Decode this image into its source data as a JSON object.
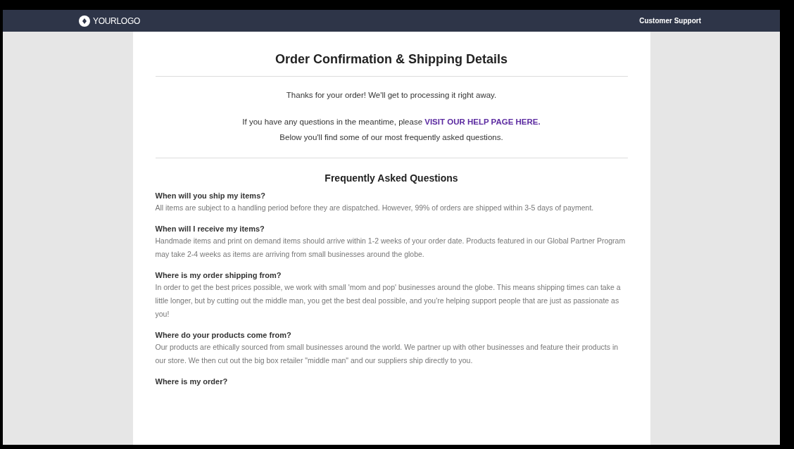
{
  "header": {
    "logo": "YOURLOGO",
    "link": "Customer Support"
  },
  "title": "Order Confirmation & Shipping Details",
  "thanks": "Thanks for your order! We'll get to processing it right away.",
  "help": {
    "before": "If you have any questions in the meantime, please ",
    "link": "VISIT OUR HELP PAGE HERE.",
    "after": "Below you'll find some of our most frequently asked questions."
  },
  "faq_title": "Frequently Asked Questions",
  "faq": [
    {
      "question": "When will you ship my items?",
      "answer": "All items are subject to a handling period before they are dispatched. However, 99% of orders are shipped within 3-5 days of payment."
    },
    {
      "question": "When will I receive my items?",
      "answer": "Handmade items and print on demand items should arrive within 1-2 weeks of your order date. Products featured in our Global Partner Program may take 2-4 weeks as items are arriving from small businesses around the globe."
    },
    {
      "question": "Where is my order shipping from?",
      "answer": "In order to get the best prices possible, we work with small 'mom and pop' businesses around the globe. This means shipping times can take a little longer, but by cutting out the middle man, you get the best deal possible, and you're helping support people that are just as passionate as you!"
    },
    {
      "question": "Where do your products come from?",
      "answer": "Our products are ethically sourced from small businesses around the world. We partner up with other businesses and feature their products in our store. We then cut out the big box retailer \"middle man\" and our suppliers ship directly to you."
    },
    {
      "question": "Where is my order?"
    }
  ]
}
